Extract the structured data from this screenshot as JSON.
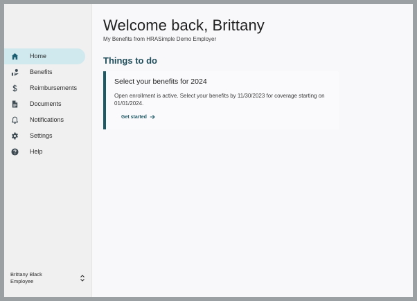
{
  "sidebar": {
    "items": [
      {
        "label": "Home",
        "icon": "home-icon",
        "active": true
      },
      {
        "label": "Benefits",
        "icon": "benefits-icon",
        "active": false
      },
      {
        "label": "Reimbursements",
        "icon": "dollar-icon",
        "active": false
      },
      {
        "label": "Documents",
        "icon": "document-icon",
        "active": false
      },
      {
        "label": "Notifications",
        "icon": "bell-icon",
        "active": false
      },
      {
        "label": "Settings",
        "icon": "gear-icon",
        "active": false
      },
      {
        "label": "Help",
        "icon": "help-icon",
        "active": false
      }
    ],
    "user": {
      "name": "Brittany Black",
      "role": "Employee"
    }
  },
  "main": {
    "welcome": "Welcome back, Brittany",
    "subtitle": "My Benefits from HRASimple Demo Employer",
    "section_title": "Things to do",
    "card": {
      "title": "Select your benefits for 2024",
      "body": "Open enrollment is active. Select your benefits by 11/30/2023 for coverage starting on 01/01/2024.",
      "link": "Get started"
    }
  },
  "colors": {
    "accent": "#1e5966",
    "active_bg": "#cfe9ee",
    "sidebar_bg": "#f0f0f0",
    "content_bg": "#f8f8fb"
  }
}
